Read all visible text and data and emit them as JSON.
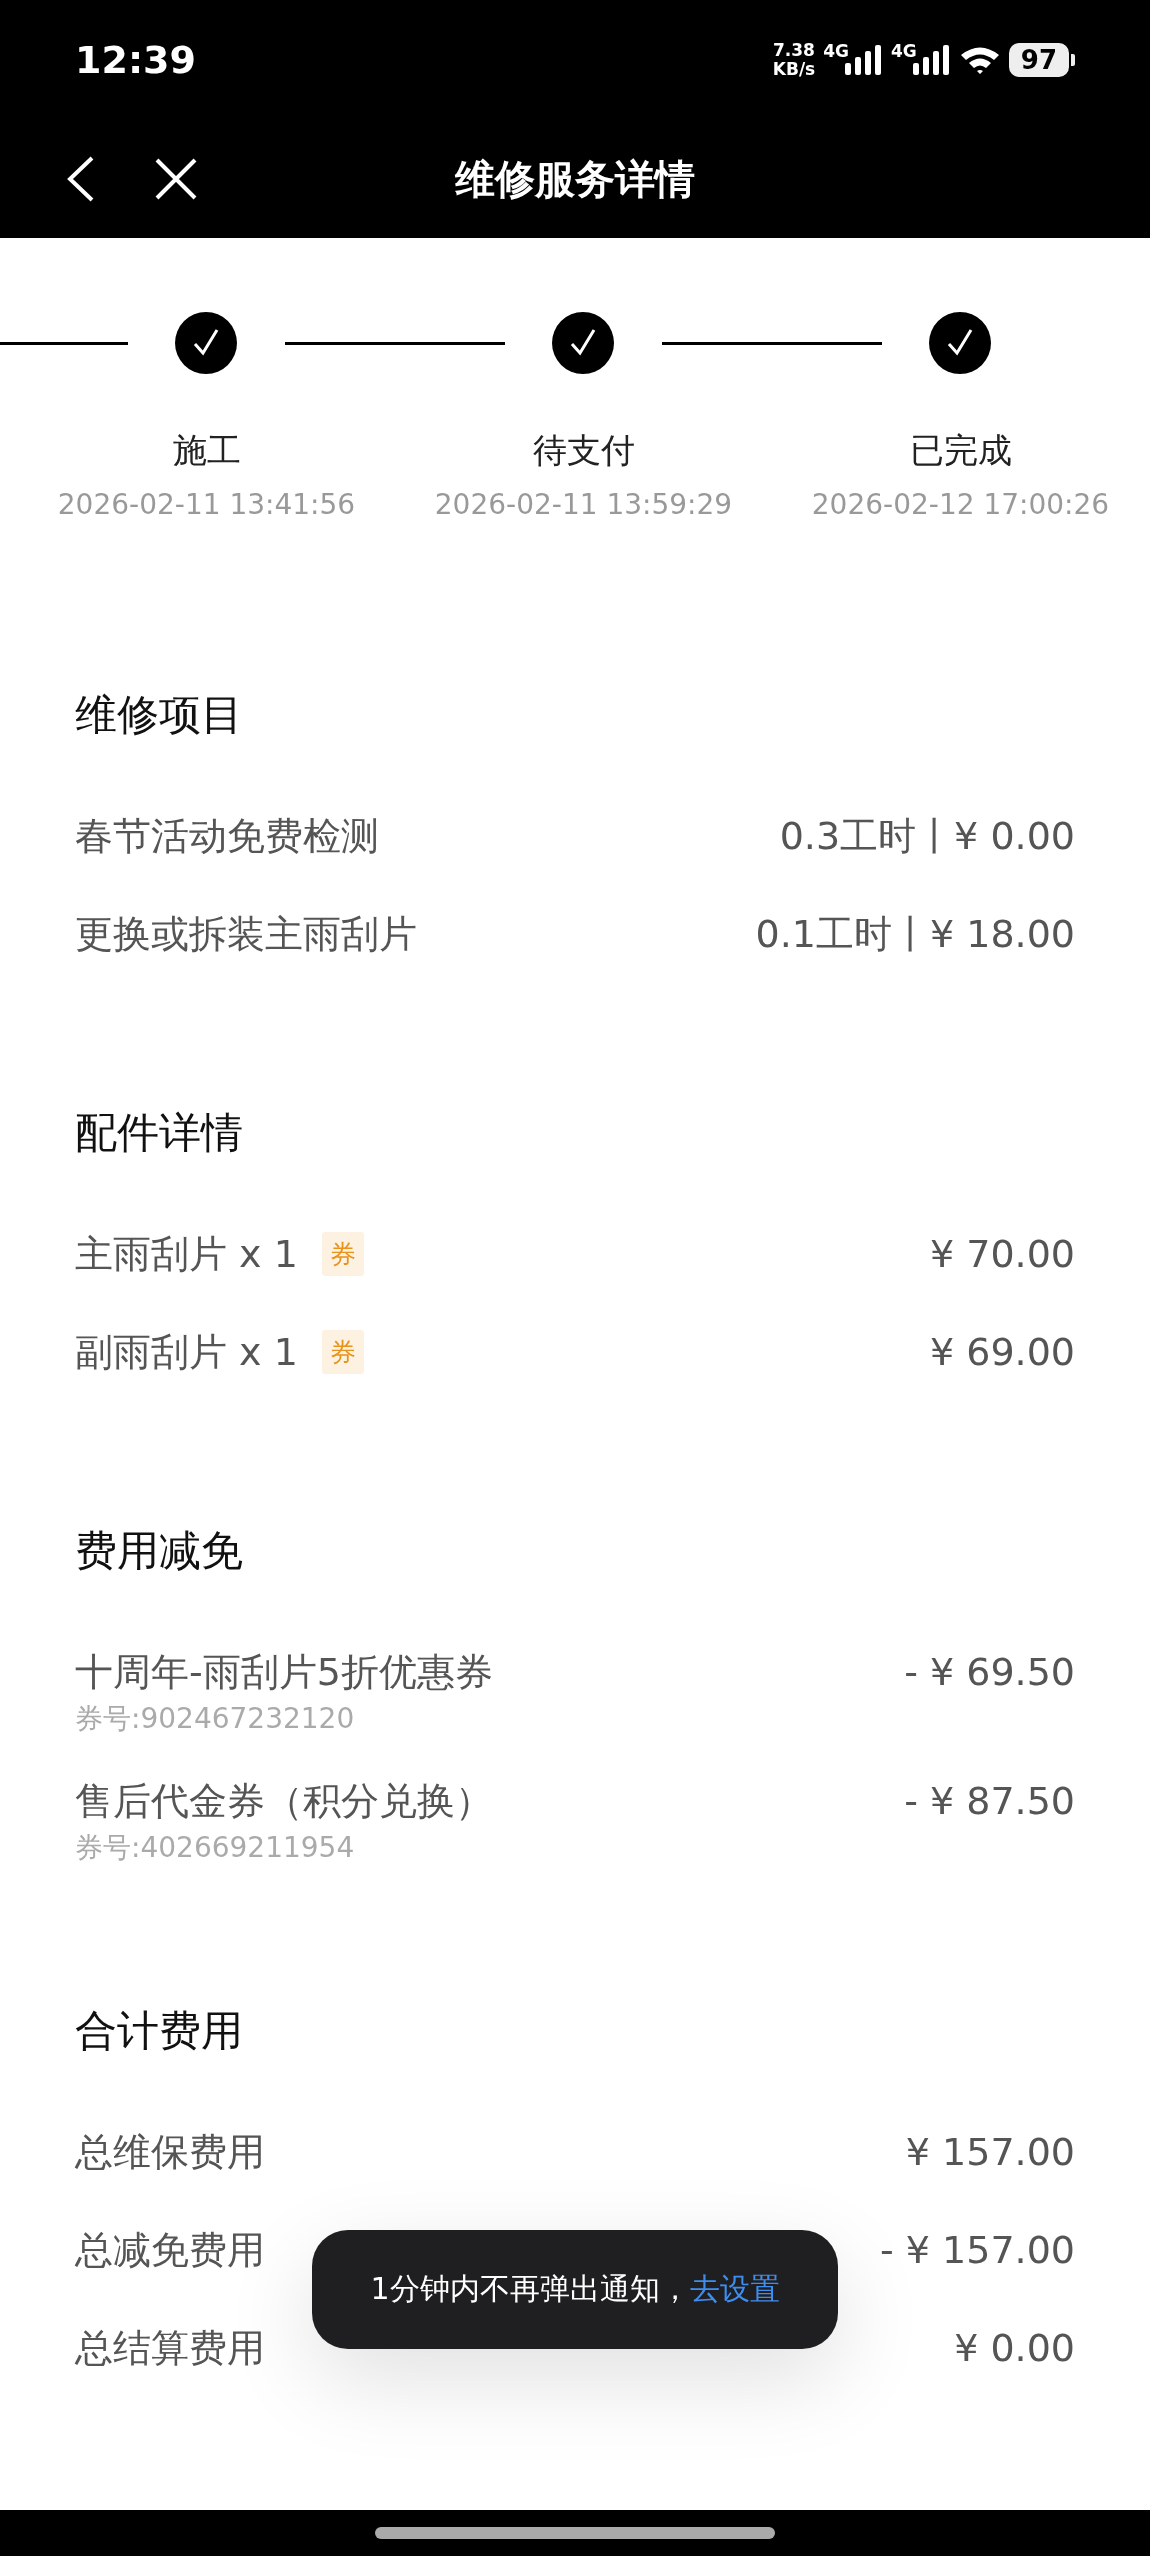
{
  "status_bar": {
    "time": "12:39",
    "speed": "7.38",
    "speed_unit": "KB/s",
    "networks": [
      "4G",
      "4G"
    ],
    "battery": "97"
  },
  "nav": {
    "title": "维修服务详情"
  },
  "steps": [
    {
      "label": "施工",
      "time": "2026-02-11 13:41:56"
    },
    {
      "label": "待支付",
      "time": "2026-02-11 13:59:29"
    },
    {
      "label": "已完成",
      "time": "2026-02-12 17:00:26"
    }
  ],
  "sections": [
    {
      "title": "维修项目",
      "rows": [
        {
          "name": "春节活动免费检测",
          "value": "0.3工时丨¥ 0.00"
        },
        {
          "name": "更换或拆装主雨刮片",
          "value": "0.1工时丨¥ 18.00"
        }
      ]
    },
    {
      "title": "配件详情",
      "rows": [
        {
          "name": "主雨刮片 x 1",
          "tag": "券",
          "value": "¥ 70.00"
        },
        {
          "name": "副雨刮片 x 1",
          "tag": "券",
          "value": "¥ 69.00"
        }
      ]
    },
    {
      "title": "费用减免",
      "rows": [
        {
          "name": "十周年-雨刮片5折优惠券",
          "sub": "券号:902467232120",
          "value": "- ¥ 69.50"
        },
        {
          "name": "售后代金券（积分兑换）",
          "sub": "券号:402669211954",
          "value": "- ¥ 87.50"
        }
      ]
    },
    {
      "title": "合计费用",
      "rows": [
        {
          "name": "总维保费用",
          "value": "¥ 157.00"
        },
        {
          "name": "总减免费用",
          "value": "- ¥ 157.00"
        },
        {
          "name": "总结算费用",
          "value": "¥ 0.00"
        }
      ]
    }
  ],
  "toast": {
    "text": "1分钟内不再弹出通知，",
    "link": "去设置"
  }
}
